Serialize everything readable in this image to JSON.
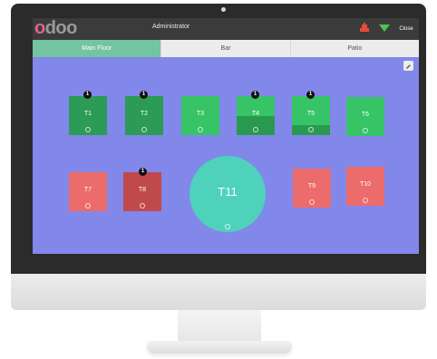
{
  "app": {
    "logo": {
      "first_letter": "o",
      "rest": "doo"
    },
    "user_name": "Administrator",
    "close_label": "Close",
    "colors": {
      "topbar": "#3b3b3b",
      "active_tab": "#74c3a2",
      "floor": "#8287ea"
    }
  },
  "floor_tabs": [
    {
      "label": "Main Floor",
      "active": true
    },
    {
      "label": "Bar",
      "active": false
    },
    {
      "label": "Patio",
      "active": false
    }
  ],
  "tables": [
    {
      "name": "T1",
      "color": "#2c9b55",
      "occupancy": 1.0,
      "badge": "1"
    },
    {
      "name": "T2",
      "color": "#2c9b55",
      "occupancy": 1.0,
      "badge": "1"
    },
    {
      "name": "T3",
      "color": "#36c467",
      "occupancy": 0,
      "badge": ""
    },
    {
      "name": "T4",
      "color": "#36c467",
      "occupancy": 0.5,
      "badge": "1"
    },
    {
      "name": "T5",
      "color": "#36c467",
      "occupancy": 0.25,
      "badge": "1"
    },
    {
      "name": "T6",
      "color": "#36c467",
      "occupancy": 0,
      "badge": ""
    },
    {
      "name": "T7",
      "color": "#ec6b6b",
      "occupancy": 0,
      "badge": ""
    },
    {
      "name": "T8",
      "color": "#c0494b",
      "occupancy": 1.0,
      "badge": "1"
    },
    {
      "name": "T11",
      "color": "#4fd2bc",
      "occupancy": 0,
      "badge": ""
    },
    {
      "name": "T9",
      "color": "#ec6b6b",
      "occupancy": 0,
      "badge": ""
    },
    {
      "name": "T10",
      "color": "#ec6b6b",
      "occupancy": 0,
      "badge": ""
    }
  ]
}
